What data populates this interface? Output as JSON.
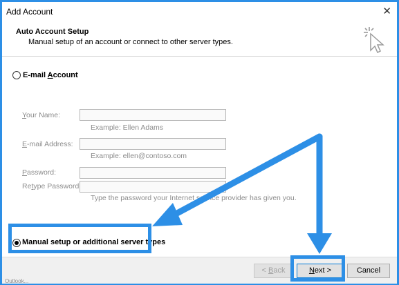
{
  "window": {
    "title": "Add Account"
  },
  "header": {
    "title": "Auto Account Setup",
    "subtitle": "Manual setup of an account or connect to other server types."
  },
  "options": {
    "email_account_pre": "E-mail ",
    "email_account_u": "A",
    "email_account_post": "ccount",
    "manual_label": "Manual setup or additional server types"
  },
  "form": {
    "your_name_pre": "",
    "your_name_u": "Y",
    "your_name_post": "our Name:",
    "your_name_hint": "Example: Ellen Adams",
    "email_pre": "",
    "email_u": "E",
    "email_post": "-mail Address:",
    "email_hint": "Example: ellen@contoso.com",
    "password_pre": "",
    "password_u": "P",
    "password_post": "assword:",
    "retype_pre": "Re",
    "retype_u": "t",
    "retype_post": "ype Password:",
    "password_hint": "Type the password your Internet service provider has given you."
  },
  "buttons": {
    "back_pre": "< ",
    "back_u": "B",
    "back_post": "ack",
    "next_pre": "",
    "next_u": "N",
    "next_post": "ext >",
    "cancel": "Cancel"
  },
  "status_text": "Outlook...",
  "colors": {
    "highlight": "#2d8fe6"
  }
}
